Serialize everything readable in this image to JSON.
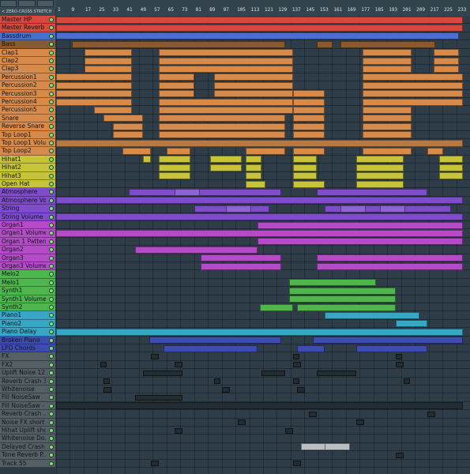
{
  "header": {
    "mode_label": "< ZERO-CROSS  STRETCH"
  },
  "ruler": {
    "ticks": [
      "1",
      "9",
      "17",
      "25",
      "33",
      "41",
      "49",
      "57",
      "65",
      "73",
      "81",
      "89",
      "97",
      "105",
      "113",
      "121",
      "129",
      "137",
      "145",
      "153",
      "161",
      "169",
      "177",
      "185",
      "193",
      "201",
      "209",
      "217",
      "225",
      "233"
    ]
  },
  "colors": {
    "red": "#d9483f",
    "blue": "#4b6fd0",
    "brown": "#8a5a2c",
    "orange": "#d88a4b",
    "yellow": "#c7c43a",
    "purple": "#7f4ccc",
    "magenta": "#b54bc9",
    "green": "#4fb54d",
    "cyan": "#36a7c4",
    "navy": "#3e4cb0",
    "gray": "#546066"
  },
  "tracks": [
    {
      "label": "Master HP",
      "color": "#d9483f"
    },
    {
      "label": "Master Reverb",
      "color": "#d9483f"
    },
    {
      "label": "Bassdrum",
      "color": "#4b6fd0"
    },
    {
      "label": "Bass",
      "color": "#8a5a2c"
    },
    {
      "label": "Clap1",
      "color": "#d88a4b"
    },
    {
      "label": "Clap2",
      "color": "#d88a4b"
    },
    {
      "label": "Clap3",
      "color": "#d88a4b"
    },
    {
      "label": "Percussion1",
      "color": "#d88a4b"
    },
    {
      "label": "Percussion2",
      "color": "#d88a4b"
    },
    {
      "label": "Percussion3",
      "color": "#d88a4b"
    },
    {
      "label": "Percussion4",
      "color": "#d88a4b"
    },
    {
      "label": "Percussion5",
      "color": "#d88a4b"
    },
    {
      "label": "Snare",
      "color": "#d88a4b"
    },
    {
      "label": "Reverse Snare",
      "color": "#d88a4b"
    },
    {
      "label": "Top Loop1",
      "color": "#d88a4b"
    },
    {
      "label": "Top Loop1 Volu...",
      "color": "#d88a4b"
    },
    {
      "label": "Top Loop2",
      "color": "#d88a4b"
    },
    {
      "label": "Hihat1",
      "color": "#c7c43a"
    },
    {
      "label": "Hihat2",
      "color": "#c7c43a"
    },
    {
      "label": "Hihat3",
      "color": "#c7c43a"
    },
    {
      "label": "Open Hat",
      "color": "#c7c43a"
    },
    {
      "label": "Atmosphere",
      "color": "#7f4ccc"
    },
    {
      "label": "Atmosphere Vo...",
      "color": "#7f4ccc"
    },
    {
      "label": "String",
      "color": "#7f4ccc"
    },
    {
      "label": "String Volume",
      "color": "#7f4ccc"
    },
    {
      "label": "Organ1",
      "color": "#b54bc9"
    },
    {
      "label": "Organ1 Volume",
      "color": "#b54bc9"
    },
    {
      "label": "Organ 1 Pattern...",
      "color": "#b54bc9"
    },
    {
      "label": "Organ2",
      "color": "#b54bc9"
    },
    {
      "label": "Organ3",
      "color": "#b54bc9"
    },
    {
      "label": "Organ3 Volume",
      "color": "#b54bc9"
    },
    {
      "label": "Melo2",
      "color": "#4fb54d"
    },
    {
      "label": "Melo1",
      "color": "#4fb54d"
    },
    {
      "label": "Synth1",
      "color": "#4fb54d"
    },
    {
      "label": "Synth1 Volume",
      "color": "#4fb54d"
    },
    {
      "label": "Synth2",
      "color": "#4fb54d"
    },
    {
      "label": "Piano1",
      "color": "#36a7c4"
    },
    {
      "label": "Piano2",
      "color": "#36a7c4"
    },
    {
      "label": "Piano Delay",
      "color": "#36a7c4"
    },
    {
      "label": "Broken Piano",
      "color": "#3e4cb0"
    },
    {
      "label": "LFO Chords",
      "color": "#3e4cb0"
    },
    {
      "label": "FX",
      "color": "#546066"
    },
    {
      "label": "FX2",
      "color": "#546066"
    },
    {
      "label": "Uplift Noise 12...",
      "color": "#546066"
    },
    {
      "label": "Reverb Crash 3",
      "color": "#546066"
    },
    {
      "label": "Whitenoise",
      "color": "#546066"
    },
    {
      "label": "Fill NoiseSaw",
      "color": "#546066"
    },
    {
      "label": "Fill NoiseSaw - ...",
      "color": "#546066"
    },
    {
      "label": "Reverb Crash ...",
      "color": "#546066"
    },
    {
      "label": "Noise FX short ...",
      "color": "#546066"
    },
    {
      "label": "Hihat Uplift sho...",
      "color": "#546066"
    },
    {
      "label": "Whitenoise Do...",
      "color": "#546066"
    },
    {
      "label": "Delayed Crash ...",
      "color": "#546066"
    },
    {
      "label": "Tone Reverb P...",
      "color": "#546066"
    },
    {
      "label": "Track 55",
      "color": "#546066"
    }
  ],
  "envelopes": [
    {
      "row": 0,
      "start": 0,
      "end": 515,
      "label": "Master HP envelope",
      "color": "#d9483f"
    },
    {
      "row": 1,
      "start": 0,
      "end": 515,
      "label": "Master Reverb envelope",
      "color": "#d9483f"
    },
    {
      "row": 15,
      "start": 0,
      "end": 515,
      "label": "Top Loop1 Volume envelope",
      "color": "#b87a44"
    },
    {
      "row": 22,
      "start": 0,
      "end": 515,
      "label": "Atmosphere Volume envelope",
      "color": "#7f4ccc"
    },
    {
      "row": 24,
      "start": 0,
      "end": 515,
      "label": "String Volume envelope",
      "color": "#7f4ccc"
    },
    {
      "row": 26,
      "start": 0,
      "end": 515,
      "label": "Organ1 Volume envelope",
      "color": "#b54bc9"
    },
    {
      "row": 38,
      "start": 0,
      "end": 515,
      "label": "Piano Delay envelope",
      "color": "#36a7c4"
    },
    {
      "row": 47,
      "start": 0,
      "end": 515,
      "label": "Fill NoiseSaw - Channel volume envelope",
      "color": "#222d33"
    }
  ],
  "clip_labels": {
    "atmosphere": "Atmo...",
    "string": "Strin...",
    "whitenoise": "Whitenoise..."
  }
}
